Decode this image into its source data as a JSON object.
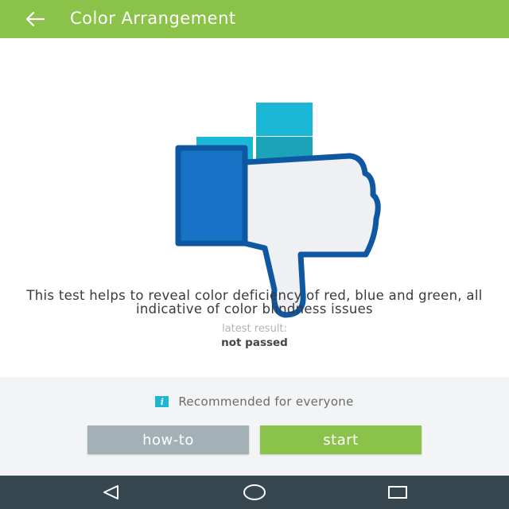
{
  "appbar": {
    "title": "Color Arrangement",
    "back_icon": "arrow-left-icon",
    "color": "#8bc34a"
  },
  "main": {
    "illustration_icon": "thumbs-down-icon",
    "description": "This test helps to reveal color deficiency of red, blue and green, all indicative of color blindness issues",
    "result_label": "latest result:",
    "result_value": "not passed"
  },
  "bottom": {
    "info_icon_glyph": "i",
    "recommend_text": "Recommended for everyone",
    "howto_label": "how-to",
    "start_label": "start"
  },
  "colors": {
    "accent_green": "#8bc34a",
    "secondary_gray": "#a3b0b6",
    "info_cyan": "#1fb6d4",
    "navbar": "#37474f"
  },
  "navbar": {
    "icons": [
      "back-triangle-icon",
      "home-circle-icon",
      "recents-square-icon"
    ]
  }
}
